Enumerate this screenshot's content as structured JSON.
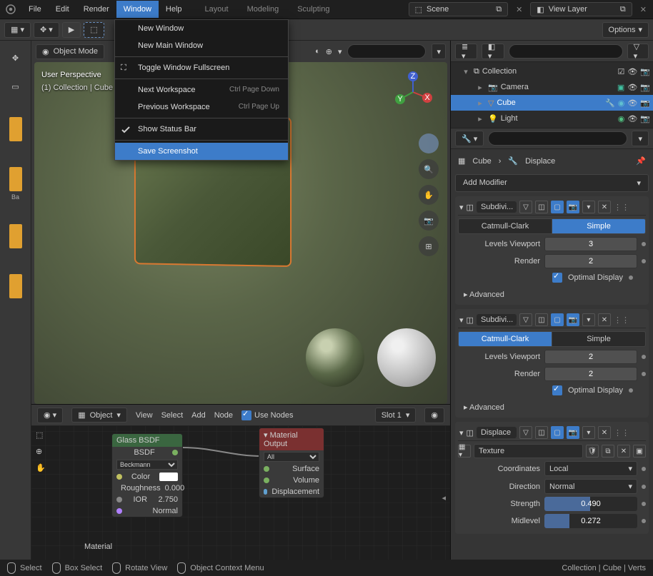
{
  "menu": {
    "file": "File",
    "edit": "Edit",
    "render": "Render",
    "window": "Window",
    "help": "Help"
  },
  "workspaces": {
    "layout": "Layout",
    "modeling": "Modeling",
    "sculpting": "Sculpting"
  },
  "scene": {
    "label": "Scene",
    "layer": "View Layer"
  },
  "toolbar": {
    "options": "Options"
  },
  "mode": "Object Mode",
  "dropdown": {
    "new_window": "New Window",
    "new_main": "New Main Window",
    "toggle_fs": "Toggle Window Fullscreen",
    "next_ws": "Next Workspace",
    "next_ws_hot": "Ctrl Page Down",
    "prev_ws": "Previous Workspace",
    "prev_ws_hot": "Ctrl Page Up",
    "show_sb": "Show Status Bar",
    "screenshot": "Save Screenshot"
  },
  "info": {
    "l1": "User Perspective",
    "l2": "(1) Collection | Cube"
  },
  "outliner": {
    "collection": "Collection",
    "camera": "Camera",
    "cube": "Cube",
    "light": "Light"
  },
  "props": {
    "obj": "Cube",
    "mod": "Displace",
    "add": "Add Modifier",
    "subdiv": "Subdivi...",
    "catmull": "Catmull-Clark",
    "simple": "Simple",
    "levels_vp": "Levels Viewport",
    "render": "Render",
    "optimal": "Optimal Display",
    "advanced": "Advanced",
    "displace": "Displace",
    "texture_lbl": "Texture",
    "coords": "Coordinates",
    "coords_v": "Local",
    "direction": "Direction",
    "direction_v": "Normal",
    "strength": "Strength",
    "strength_v": "0.490",
    "midlevel": "Midlevel",
    "midlevel_v": "0.272",
    "sub1": {
      "vp": "3",
      "rn": "2"
    },
    "sub2": {
      "vp": "2",
      "rn": "2"
    }
  },
  "nodes": {
    "view": "View",
    "select": "Select",
    "add": "Add",
    "node": "Node",
    "object": "Object",
    "use_nodes": "Use Nodes",
    "slot": "Slot 1",
    "glass": "Glass BSDF",
    "bsdf": "BSDF",
    "beckmann": "Beckmann",
    "color": "Color",
    "rough": "Roughness",
    "rough_v": "0.000",
    "ior": "IOR",
    "ior_v": "2.750",
    "normal": "Normal",
    "mat_out": "Material Output",
    "all": "All",
    "surface": "Surface",
    "volume": "Volume",
    "disp": "Displacement",
    "mat_lbl": "Material"
  },
  "status": {
    "select": "Select",
    "box": "Box Select",
    "rotate": "Rotate View",
    "ctx": "Object Context Menu",
    "path": "Collection | Cube | Verts"
  }
}
